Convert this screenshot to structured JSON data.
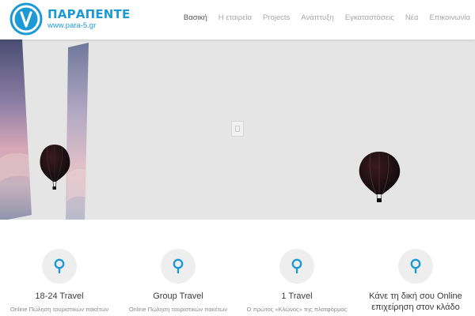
{
  "brand": {
    "name": "ΠΑΡΑΠΕΝΤΕ",
    "url": "www.para-5.gr",
    "color": "#1d9ad6"
  },
  "nav": {
    "items": [
      "Βασική",
      "Η εταιρεία",
      "Projects",
      "Ανάπτυξη",
      "Εγκαταστάσεις",
      "Νέα",
      "Επικοινωνία"
    ],
    "active_index": 0
  },
  "hero": {
    "play_icon": "play-placeholder-icon"
  },
  "features": [
    {
      "icon": "map-pin-icon",
      "title": "18-24 Travel",
      "desc": "Online Πώληση τουριστικών πακέτων"
    },
    {
      "icon": "map-pin-icon",
      "title": "Group Travel",
      "desc": "Online Πώληση τουριστικών πακέτων"
    },
    {
      "icon": "map-pin-icon",
      "title": "1 Travel",
      "desc": "Ο πρώτος «Κλώνος» της πλατφόρμας"
    },
    {
      "icon": "map-pin-icon",
      "title": "Κάνε τη δική σου Online επιχείρηση στον κλάδο",
      "desc": ""
    }
  ],
  "colors": {
    "accent": "#1d9ad6",
    "hero_background": "#e5e5e5",
    "icon_background": "#eeeeee"
  }
}
